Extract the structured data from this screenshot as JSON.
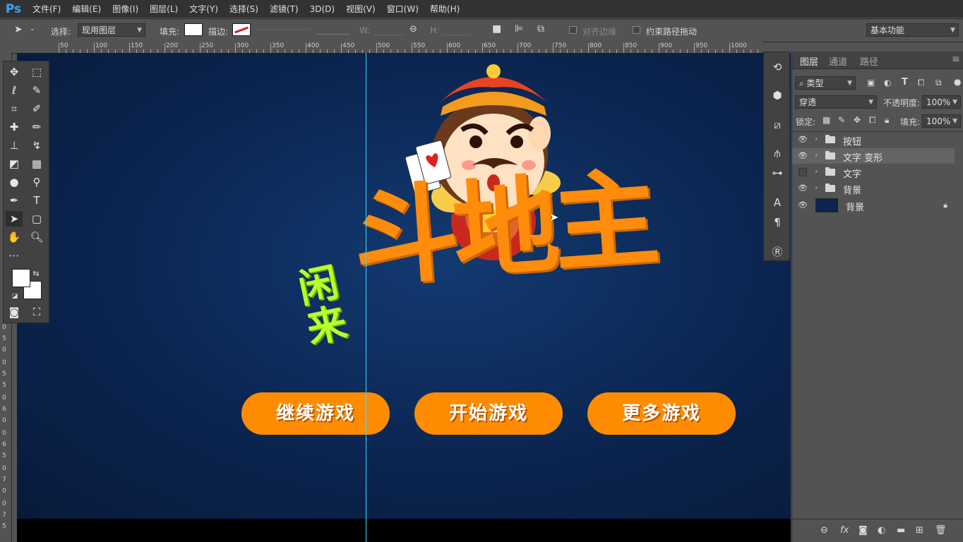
{
  "app": {
    "logo": "Ps"
  },
  "menu": [
    "文件(F)",
    "编辑(E)",
    "图像(I)",
    "图层(L)",
    "文字(Y)",
    "选择(S)",
    "滤镜(T)",
    "3D(D)",
    "视图(V)",
    "窗口(W)",
    "帮助(H)"
  ],
  "options": {
    "select_label": "选择:",
    "select_value": "现用图层",
    "fill_label": "填充:",
    "stroke_label": "描边:",
    "w_label": "W:",
    "h_label": "H:",
    "align_edges": "对齐边缘",
    "constrain_path": "约束路径拖动",
    "workspace": "基本功能"
  },
  "ruler_h": [
    "50",
    "100",
    "150",
    "200",
    "250",
    "300",
    "350",
    "400",
    "450",
    "500",
    "550",
    "600",
    "650",
    "700",
    "750",
    "800",
    "850",
    "900",
    "950",
    "1000"
  ],
  "ruler_v": [
    "0",
    "5",
    "0",
    "0",
    "5",
    "5",
    "0",
    "6",
    "0",
    "0",
    "6",
    "5",
    "0",
    "7",
    "0",
    "0",
    "7",
    "5"
  ],
  "artwork": {
    "title_small": "闲来",
    "title_main": "斗地主",
    "buttons": [
      "继续游戏",
      "开始游戏",
      "更多游戏"
    ]
  },
  "panel": {
    "tabs": [
      "图层",
      "通道",
      "路径"
    ],
    "filter_kind": "类型",
    "blend_mode": "穿透",
    "opacity_label": "不透明度:",
    "opacity_value": "100%",
    "lock_label": "锁定:",
    "fill_label": "填充:",
    "fill_value": "100%",
    "layers": [
      {
        "name": "按钮",
        "visible": true,
        "type": "group"
      },
      {
        "name": "文字 变形",
        "visible": true,
        "type": "group",
        "selected": true
      },
      {
        "name": "文字",
        "visible": false,
        "type": "group"
      },
      {
        "name": "背景",
        "visible": true,
        "type": "group"
      },
      {
        "name": "背景",
        "visible": true,
        "type": "layer",
        "locked": true
      }
    ]
  },
  "colors": {
    "accent_orange": "#ff8c00",
    "lime": "#b7ff2a",
    "canvas_bg": "#0b2550",
    "guide": "#3fd8ff"
  }
}
